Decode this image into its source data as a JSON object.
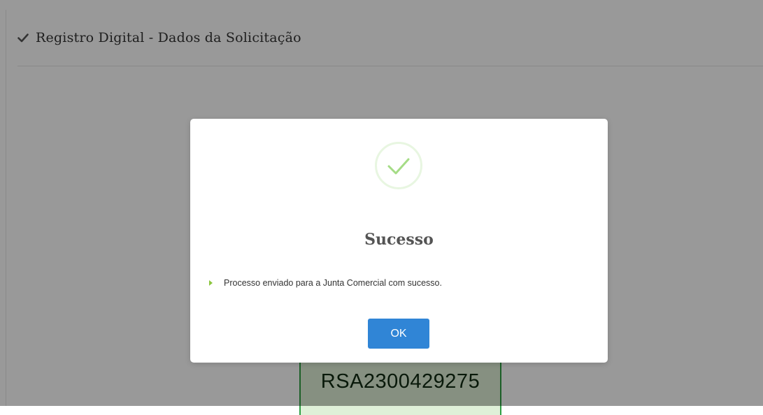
{
  "page": {
    "section_title": "Registro Digital - Dados da Solicitação",
    "protocol_number": "RSA2300429275"
  },
  "modal": {
    "title": "Sucesso",
    "message": "Processo enviado para a Junta Comercial com sucesso.",
    "ok_label": "OK",
    "icon": "success-check-icon"
  },
  "colors": {
    "overlay": "rgba(0,0,0,0.4)",
    "ok_button": "#3085d6",
    "success_check": "#a5dc86",
    "bullet": "#8cc63f",
    "protocol_border": "#2f9e44",
    "protocol_bg": "#dff0d8"
  }
}
